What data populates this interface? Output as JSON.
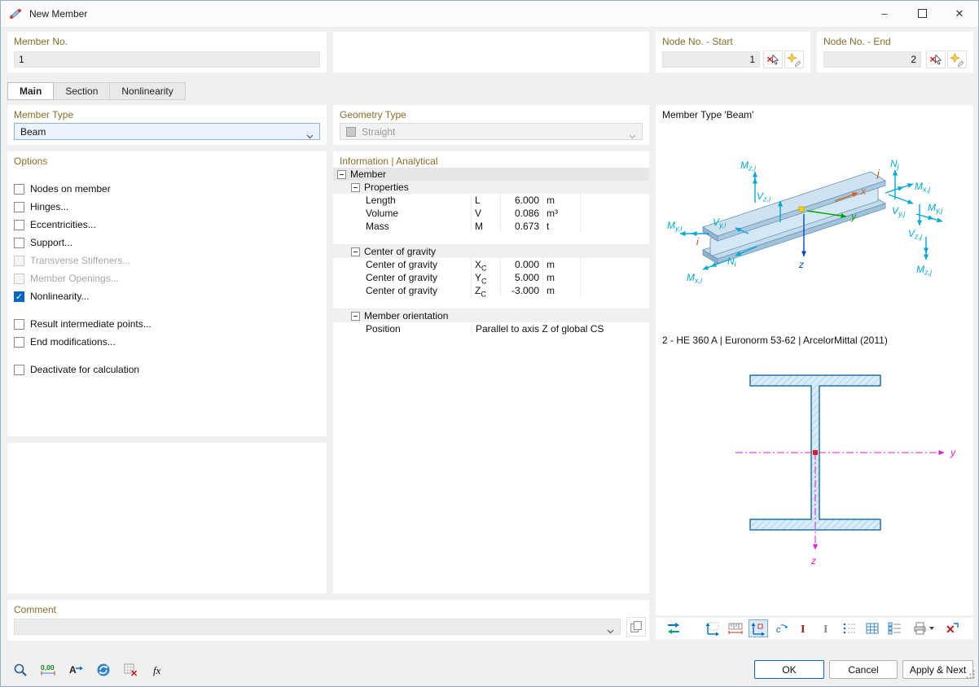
{
  "window": {
    "title": "New Member"
  },
  "icons": {
    "minimize": "–",
    "close": "✕",
    "decimal": "0,00",
    "formula": "fx",
    "letter_a": "A"
  },
  "header": {
    "member_no": {
      "label": "Member No.",
      "value": "1"
    },
    "node_start": {
      "label": "Node No. - Start",
      "value": "1"
    },
    "node_end": {
      "label": "Node No. - End",
      "value": "2"
    }
  },
  "tabs": {
    "main": "Main",
    "section": "Section",
    "nonlinearity": "Nonlinearity"
  },
  "member_type": {
    "label": "Member Type",
    "value": "Beam"
  },
  "options": {
    "label": "Options",
    "items": {
      "nodes_on_member": "Nodes on member",
      "hinges": "Hinges...",
      "eccentricities": "Eccentricities...",
      "support": "Support...",
      "transverse_stiffeners": "Transverse Stiffeners...",
      "member_openings": "Member Openings...",
      "nonlinearity": "Nonlinearity...",
      "result_points": "Result intermediate points...",
      "end_modifications": "End modifications...",
      "deactivate": "Deactivate for calculation"
    }
  },
  "geometry": {
    "label": "Geometry Type",
    "value": "Straight"
  },
  "info": {
    "label": "Information | Analytical",
    "root": "Member",
    "properties": {
      "label": "Properties",
      "rows": [
        {
          "label": "Length",
          "sym": "L",
          "sub": "",
          "value": "6.000",
          "unit": "m"
        },
        {
          "label": "Volume",
          "sym": "V",
          "sub": "",
          "value": "0.086",
          "unit": "m³"
        },
        {
          "label": "Mass",
          "sym": "M",
          "sub": "",
          "value": "0.673",
          "unit": "t"
        }
      ]
    },
    "cog": {
      "label": "Center of gravity",
      "rows": [
        {
          "label": "Center of gravity",
          "sym": "X",
          "sub": "C",
          "value": "0.000",
          "unit": "m"
        },
        {
          "label": "Center of gravity",
          "sym": "Y",
          "sub": "C",
          "value": "5.000",
          "unit": "m"
        },
        {
          "label": "Center of gravity",
          "sym": "Z",
          "sub": "C",
          "value": "-3.000",
          "unit": "m"
        }
      ]
    },
    "orientation": {
      "label": "Member orientation",
      "row": {
        "label": "Position",
        "value": "Parallel to axis Z of global CS"
      }
    }
  },
  "preview": {
    "title": "Member Type 'Beam'",
    "caption": "2 - HE 360 A | Euronorm 53-62 | ArcelorMittal (2011)",
    "beam": {
      "mzi": {
        "b": "M",
        "s": "z,i"
      },
      "vzi": {
        "b": "V",
        "s": "z,i"
      },
      "myi": {
        "b": "M",
        "s": "y,i"
      },
      "vyi": {
        "b": "V",
        "s": "y,i"
      },
      "ni": {
        "b": "N",
        "s": "i"
      },
      "mxi": {
        "b": "M",
        "s": "x,i"
      },
      "nj": {
        "b": "N",
        "s": "j"
      },
      "mxj": {
        "b": "M",
        "s": "x,j"
      },
      "vyj": {
        "b": "V",
        "s": "y,j"
      },
      "myj": {
        "b": "M",
        "s": "y,j"
      },
      "vzj": {
        "b": "V",
        "s": "z,j"
      },
      "mzj": {
        "b": "M",
        "s": "z,j"
      },
      "x": "x",
      "y": "y",
      "z": "z",
      "i": "i",
      "j": "j"
    },
    "section_axes": {
      "y": "y",
      "z": "z"
    }
  },
  "comment": {
    "label": "Comment",
    "value": ""
  },
  "footer": {
    "ok": "OK",
    "cancel": "Cancel",
    "apply_next": "Apply & Next"
  }
}
